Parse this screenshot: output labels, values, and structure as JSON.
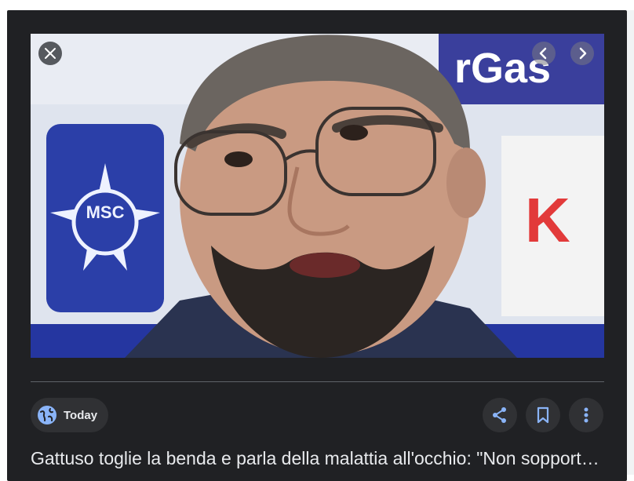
{
  "viewer": {
    "image_alt": "Gattuso in conferenza stampa",
    "backdrop_text_left": "MSC",
    "backdrop_text_right": "rGas",
    "source_label": "Today",
    "title": "Gattuso toglie la benda e parla della malattia all'occhio: \"Non sopporto più...\""
  },
  "colors": {
    "panel_bg": "#202124",
    "chip_bg": "#303134",
    "text": "#e8eaed",
    "accent_blue": "#8ab4f8"
  },
  "icons": {
    "close": "close-icon",
    "prev": "chevron-left-icon",
    "next": "chevron-right-icon",
    "globe": "globe-icon",
    "share": "share-icon",
    "bookmark": "bookmark-icon",
    "more": "more-vert-icon"
  }
}
